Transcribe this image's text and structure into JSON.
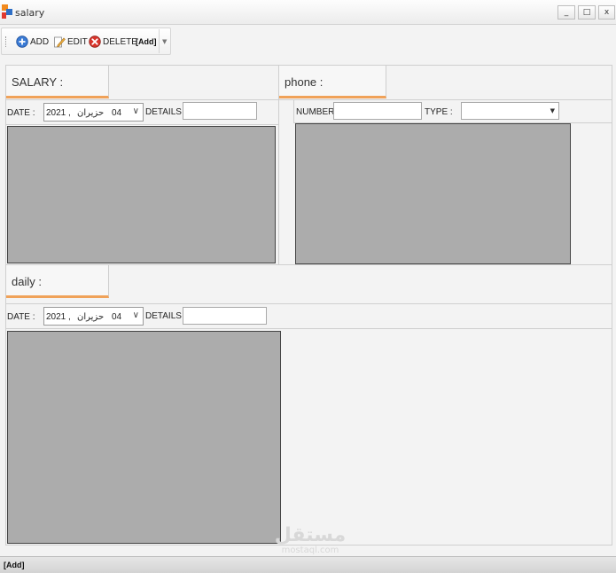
{
  "window": {
    "title": "salary",
    "controls": {
      "minimize": "_",
      "maximize": "□",
      "close": "x"
    }
  },
  "toolbar": {
    "add_label": "ADD",
    "edit_label": "EDIT",
    "delete_label": "DELETE",
    "mode_label": "[Add]",
    "overflow": "▼",
    "icons": {
      "add": "add-icon",
      "edit": "edit-icon",
      "delete": "delete-icon"
    }
  },
  "salary": {
    "tab_label": "SALARY :",
    "date_label": "DATE :",
    "date": {
      "year": "2021 ,",
      "month": "حزيران",
      "day": "04",
      "dropdown": "∨"
    },
    "details_label": "DETAILS :",
    "details_value": ""
  },
  "phone": {
    "tab_label": "phone :",
    "number_label": "NUMBER :",
    "number_value": "",
    "type_label": "TYPE :",
    "type_value": "",
    "type_arrow": "▼"
  },
  "daily": {
    "tab_label": "daily :",
    "date_label": "DATE :",
    "date": {
      "year": "2021 ,",
      "month": "حزيران",
      "day": "04",
      "dropdown": "∨"
    },
    "details_label": "DETAILS :",
    "details_value": ""
  },
  "watermark": {
    "text_ar": "مستقل",
    "text_en": "mostaql.com"
  },
  "status": {
    "mode": "[Add]"
  },
  "colors": {
    "tab_underline": "#f0a259",
    "grid_fill": "#acacac",
    "window_bg": "#f3f3f3"
  }
}
